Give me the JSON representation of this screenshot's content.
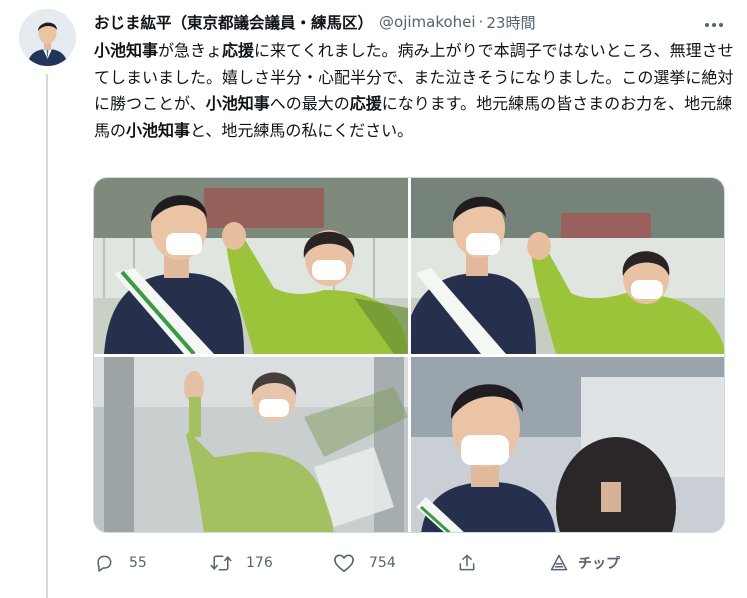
{
  "author": {
    "display_name": "おじま紘平（東京都議会議員・練馬区）",
    "handle": "@ojimakohei",
    "separator": "·",
    "time": "23時間"
  },
  "text": {
    "seg1": "小池知事",
    "seg2": "が急きょ",
    "seg3": "応援",
    "seg4": "に来てくれました。病み上がりで本調子ではないところ、無理させてしまいました。嬉しさ半分・心配半分で、また泣きそうになりました。この選挙に絶対に勝つことが、",
    "seg5": "小池知事",
    "seg6": "への最大の",
    "seg7": "応援",
    "seg8": "になります。地元練馬の皆さまのお力を、地元練馬の",
    "seg9": "小池知事",
    "seg10": "と、地元練馬の私にください。"
  },
  "media": {
    "photos": [
      {
        "subject": "campaign-photo-1"
      },
      {
        "subject": "campaign-photo-2"
      },
      {
        "subject": "campaign-photo-3"
      },
      {
        "subject": "campaign-photo-4"
      }
    ]
  },
  "actions": {
    "reply_count": "55",
    "retweet_count": "176",
    "like_count": "754",
    "tip_label": "チップ"
  },
  "icons": {
    "more": "more-dots-icon",
    "reply": "reply-icon",
    "retweet": "retweet-icon",
    "like": "heart-icon",
    "share": "share-icon",
    "tip": "tip-icon"
  },
  "colors": {
    "text": "#0f1419",
    "secondary": "#536471",
    "border": "#cfd9de",
    "jacket_green": "#9cc43a"
  }
}
